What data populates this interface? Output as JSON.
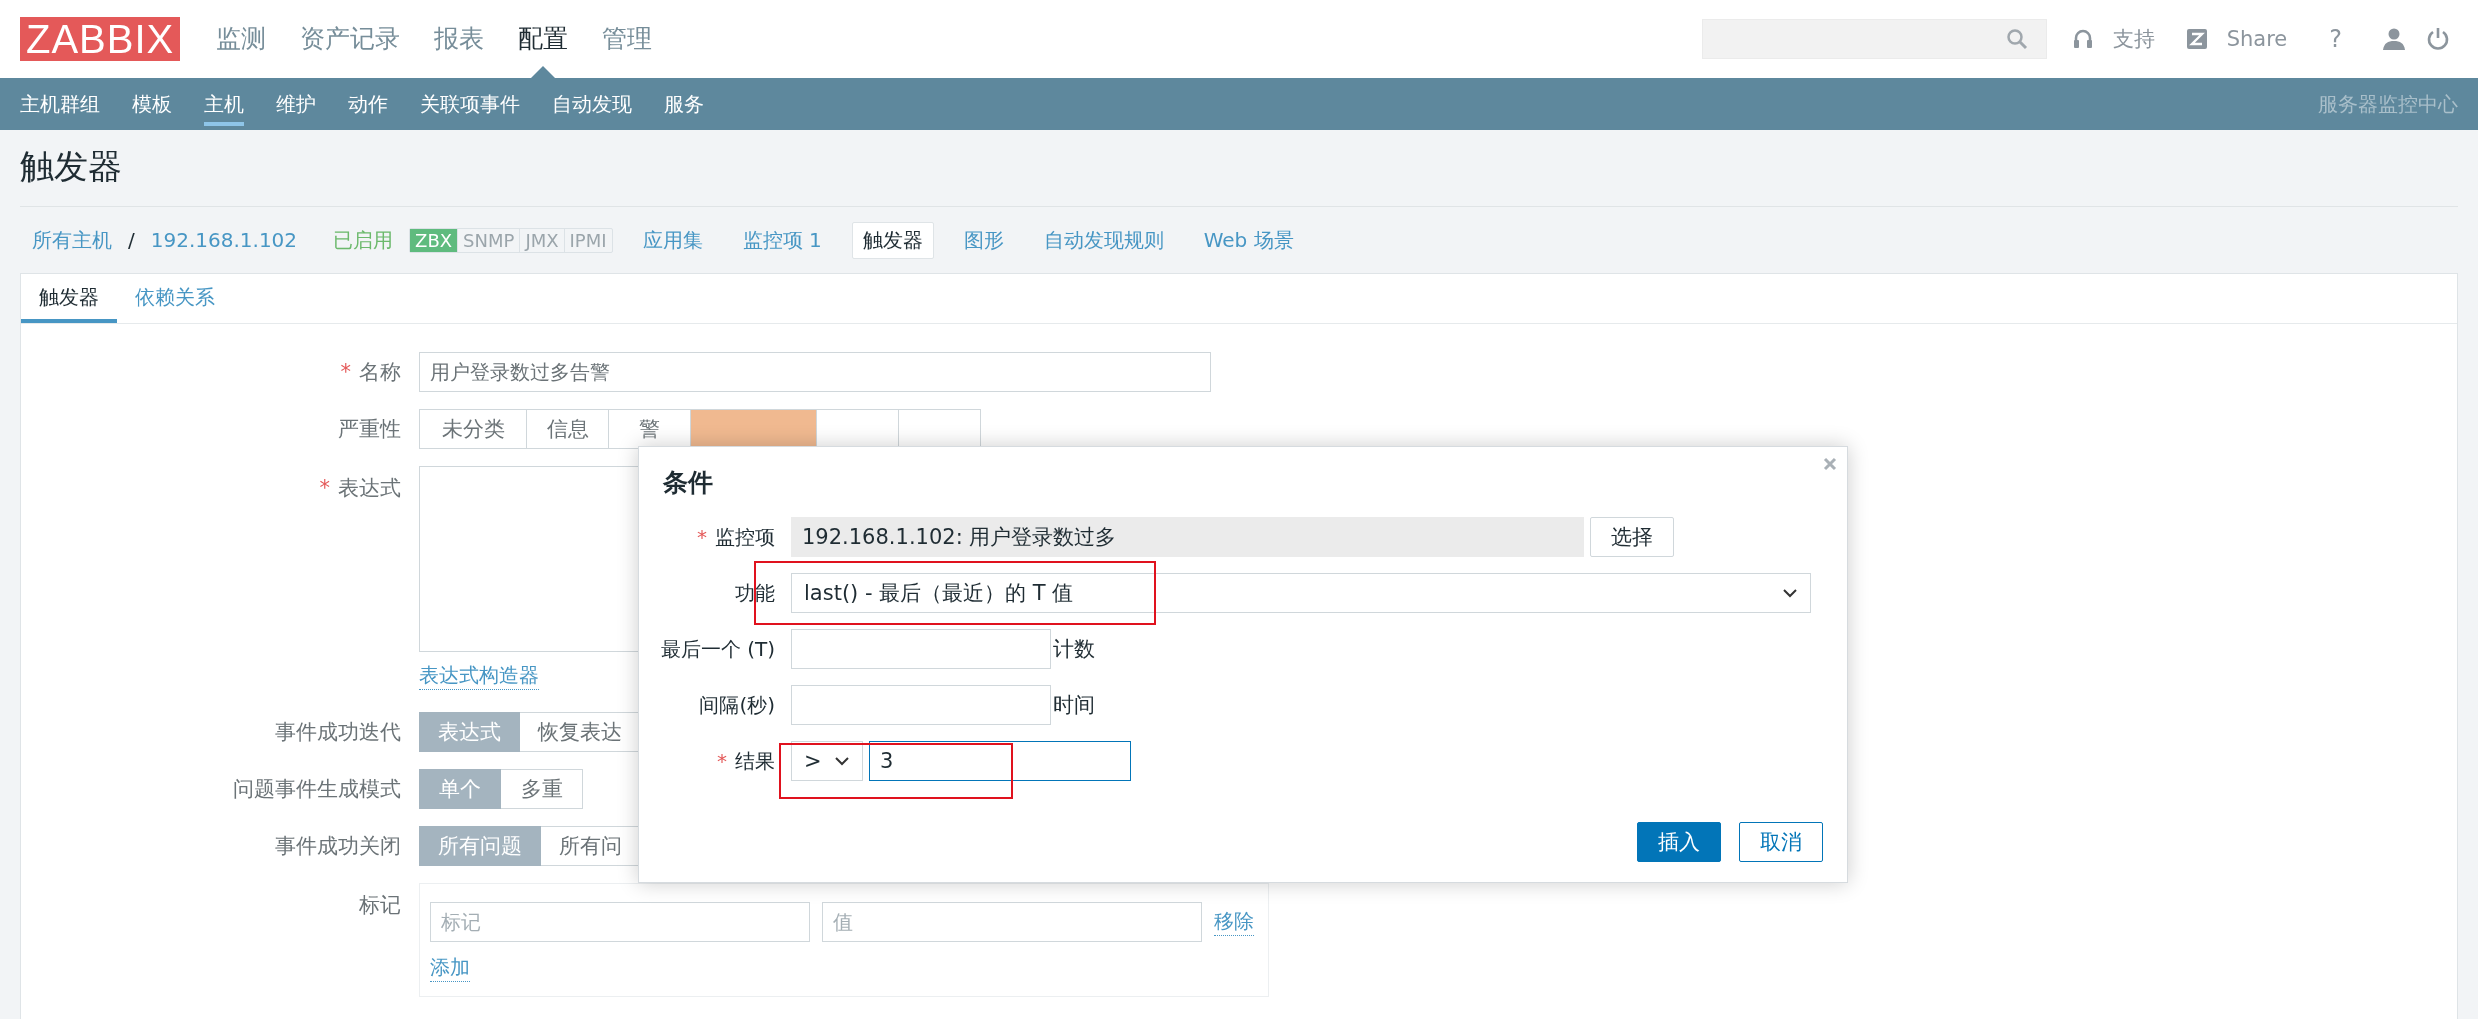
{
  "header": {
    "logo": "ZABBIX",
    "menu": [
      {
        "label": "监测",
        "selected": false
      },
      {
        "label": "资产记录",
        "selected": false
      },
      {
        "label": "报表",
        "selected": false
      },
      {
        "label": "配置",
        "selected": true
      },
      {
        "label": "管理",
        "selected": false
      }
    ],
    "support": "支持",
    "share": "Share",
    "help": "?"
  },
  "subnav": {
    "items": [
      {
        "label": "主机群组",
        "selected": false
      },
      {
        "label": "模板",
        "selected": false
      },
      {
        "label": "主机",
        "selected": true
      },
      {
        "label": "维护",
        "selected": false
      },
      {
        "label": "动作",
        "selected": false
      },
      {
        "label": "关联项事件",
        "selected": false
      },
      {
        "label": "自动发现",
        "selected": false
      },
      {
        "label": "服务",
        "selected": false
      }
    ],
    "server_name": "服务器监控中心"
  },
  "page_title": "触发器",
  "breadcrumb": {
    "items": [
      "所有主机",
      "192.168.1.102"
    ],
    "separator": "/",
    "status": "已启用",
    "availability": [
      {
        "label": "ZBX",
        "on": true
      },
      {
        "label": "SNMP",
        "on": false
      },
      {
        "label": "JMX",
        "on": false
      },
      {
        "label": "IPMI",
        "on": false
      }
    ],
    "links": [
      {
        "label": "应用集",
        "selected": false
      },
      {
        "label": "监控项 1",
        "selected": false
      },
      {
        "label": "触发器",
        "selected": true
      },
      {
        "label": "图形",
        "selected": false
      },
      {
        "label": "自动发现规则",
        "selected": false
      },
      {
        "label": "Web 场景",
        "selected": false
      }
    ]
  },
  "tabs": [
    {
      "label": "触发器",
      "selected": true
    },
    {
      "label": "依赖关系",
      "selected": false
    }
  ],
  "form": {
    "name": {
      "label": "名称",
      "required": true,
      "required_mark": "*",
      "value": "用户登录数过多告警"
    },
    "severity": {
      "label": "严重性",
      "options": [
        {
          "label": "未分类",
          "selected": false
        },
        {
          "label": "信息",
          "selected": false
        },
        {
          "label": "警",
          "selected": false
        },
        {
          "selected": true
        },
        {
          "selected": false
        },
        {
          "selected": false
        }
      ]
    },
    "expression": {
      "label": "表达式",
      "required": true,
      "required_mark": "*",
      "builder_link": "表达式构造器"
    },
    "recovery_mode": {
      "label": "事件成功迭代",
      "options": [
        {
          "label": "表达式",
          "selected": true
        },
        {
          "label": "恢复表达",
          "selected": false
        }
      ]
    },
    "problem_mode": {
      "label": "问题事件生成模式",
      "options": [
        {
          "label": "单个",
          "selected": true
        },
        {
          "label": "多重",
          "selected": false
        }
      ]
    },
    "ok_close": {
      "label": "事件成功关闭",
      "options": [
        {
          "label": "所有问题",
          "selected": true
        },
        {
          "label": "所有问",
          "selected": false
        }
      ]
    },
    "tags": {
      "label": "标记",
      "rows": [
        {
          "tag_placeholder": "标记",
          "value_placeholder": "值",
          "remove": "移除"
        }
      ],
      "add": "添加"
    }
  },
  "dialog": {
    "title": "条件",
    "item": {
      "label": "监控项",
      "required": true,
      "required_mark": "*",
      "value": "192.168.1.102: 用户登录数过多",
      "button": "选择"
    },
    "function": {
      "label": "功能",
      "value": "last() - 最后（最近）的 T 值"
    },
    "last_t": {
      "label": "最后一个 (T)",
      "suffix": "计数"
    },
    "interval": {
      "label": "间隔(秒)",
      "suffix": "时间"
    },
    "result": {
      "label": "结果",
      "required": true,
      "required_mark": "*",
      "operator": ">",
      "value": "3"
    },
    "buttons": [
      {
        "label": "插入",
        "kind": "primary"
      },
      {
        "label": "取消",
        "kind": "secondary"
      }
    ]
  }
}
